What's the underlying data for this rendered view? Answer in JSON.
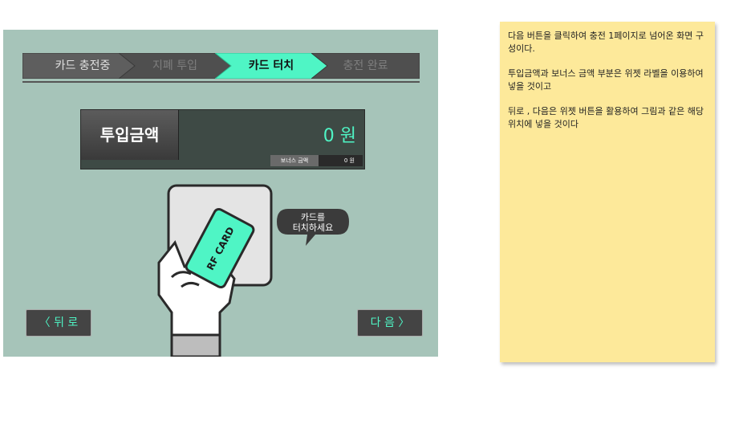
{
  "steps": [
    {
      "label": "카드 충전중"
    },
    {
      "label": "지폐 투입"
    },
    {
      "label": "카드 터치"
    },
    {
      "label": "충전 완료"
    }
  ],
  "amount": {
    "label": "투입금액",
    "value": "0 원",
    "bonus_label": "보너스 금액",
    "bonus_value": "0 원"
  },
  "card": {
    "text": "RF CARD"
  },
  "bubble": {
    "line1": "카드를",
    "line2": "터치하세요"
  },
  "nav": {
    "back": "〈 뒤 로",
    "next": "다 음 〉"
  },
  "note": {
    "p1": "다음 버튼을 클릭하여 충전 1페이지로 넘어온 화면 구성이다.",
    "p2": "투입금액과 보너스 금액 부분은 위젯 라벨을 이용하여 넣을 것이고",
    "p3": "뒤로 , 다음은 위젯 버튼을 활용하여 그림과 같은 해당위치에 넣을 것이다"
  },
  "colors": {
    "screen_bg": "#a6c4b9",
    "accent": "#4ff5c5",
    "note_bg": "#fde99a"
  }
}
